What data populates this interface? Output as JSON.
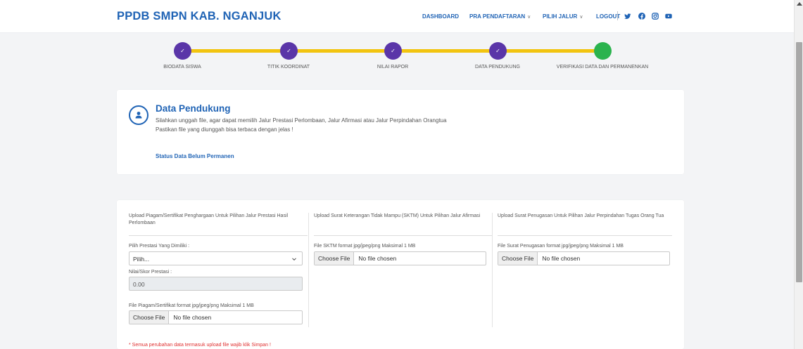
{
  "header": {
    "brand": "PPDB SMPN KAB. NGANJUK",
    "nav": [
      {
        "label": "DASHBOARD"
      },
      {
        "label": "PRA PENDAFTARAN",
        "dropdown": true
      },
      {
        "label": "PILIH JALUR",
        "dropdown": true
      },
      {
        "label": "LOGOUT"
      }
    ],
    "social_icons": [
      "twitter-icon",
      "facebook-icon",
      "instagram-icon",
      "youtube-icon"
    ],
    "brand_color": "#1f63b5"
  },
  "stepper": {
    "steps": [
      {
        "label": "BIODATA SISWA",
        "status": "complete"
      },
      {
        "label": "TITIK KOORDINAT",
        "status": "complete"
      },
      {
        "label": "NILAI RAPOR",
        "status": "complete"
      },
      {
        "label": "DATA PENDUKUNG",
        "status": "complete"
      },
      {
        "label": "VERIFIKASI DATA DAN PERMANENKAN",
        "status": "current"
      }
    ],
    "check_glyph": "✓",
    "line_color": "#f2c40f",
    "complete_color": "#5a35a8",
    "current_color": "#2bb34e"
  },
  "info": {
    "title": "Data Pendukung",
    "line1": "Silahkan unggah file, agar dapat memilih Jalur Prestasi Perlombaan, Jalur Afirmasi atau Jalur Perpindahan Orangtua",
    "line2": "Pastikan file yang diunggah bisa terbaca dengan jelas !",
    "status": "Status Data Belum Permanen"
  },
  "upload": {
    "col1": {
      "heading": "Upload Piagam/Sertifikat Penghargaan Untuk Pilihan Jalur Prestasi Hasil Perlombaan",
      "prestasi_label": "Pilih Prestasi Yang Dimiliki :",
      "prestasi_value": "Pilih...",
      "nilai_label": "Nilai/Skor Prestasi :",
      "nilai_value": "0.00",
      "file_label": "File Piagam/Sertifikat format jpg/jpeg/png Maksimal 1 MB",
      "file_button": "Choose File",
      "file_status": "No file chosen"
    },
    "col2": {
      "heading": "Upload Surat Keterangan Tidak Mampu (SKTM) Untuk Pilihan Jalur Afirmasi",
      "file_label": "File SKTM format jpg/jpeg/png Maksimal 1 MB",
      "file_button": "Choose File",
      "file_status": "No file chosen"
    },
    "col3": {
      "heading": "Upload Surat Penugasan Untuk Pilihan Jalur Perpindahan Tugas Orang Tua",
      "file_label": "File Surat Penugasan format jpg/jpeg/png Maksimal 1 MB",
      "file_button": "Choose File",
      "file_status": "No file chosen"
    },
    "note": "* Semua perubahan data termasuk upload file wajib klik Simpan !"
  }
}
